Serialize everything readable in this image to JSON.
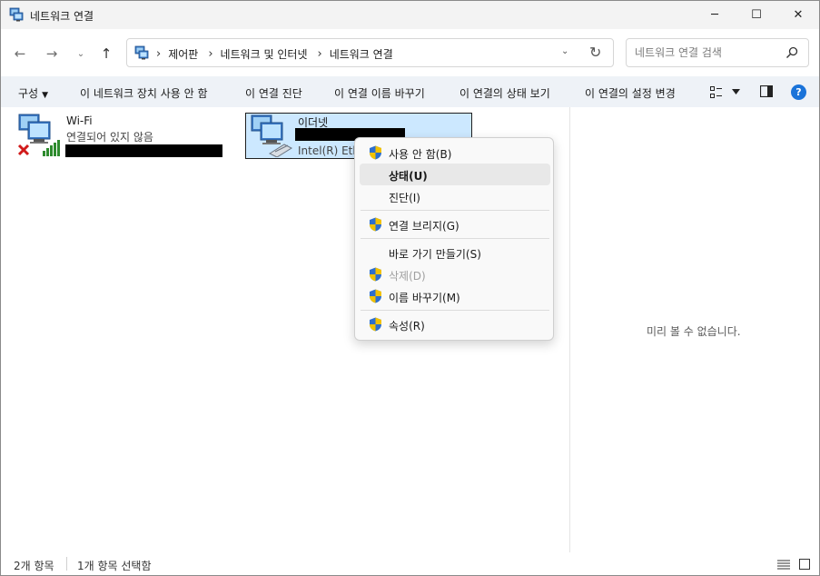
{
  "window": {
    "title": "네트워크 연결",
    "controls": {
      "minimize": "─",
      "maximize": "☐",
      "close": "✕"
    }
  },
  "navigation": {
    "back": "←",
    "forward": "→",
    "recent": "⌄",
    "up": "↑",
    "breadcrumbs": [
      "제어판",
      "네트워크 및 인터넷",
      "네트워크 연결"
    ],
    "breadcrumb_separator": "›",
    "dropdown": "⌄",
    "refresh": "↻"
  },
  "search": {
    "placeholder": "네트워크 연결 검색",
    "value": ""
  },
  "commands": {
    "organize": "구성",
    "disable": "이 네트워크 장치 사용 안 함",
    "diagnose": "이 연결 진단",
    "rename": "이 연결 이름 바꾸기",
    "view_status": "이 연결의 상태 보기",
    "change_settings": "이 연결의 설정 변경",
    "help": "?"
  },
  "connections": [
    {
      "name": "Wi-Fi",
      "status": "연결되어 있지 않음",
      "disconnected": true,
      "selected": false
    },
    {
      "name": "이더넷",
      "adapter": "Intel(R) Ethe",
      "disconnected": false,
      "selected": true
    }
  ],
  "context_menu": {
    "items": [
      {
        "label": "사용 안 함(B)",
        "shield": true,
        "bold": false,
        "disabled": false,
        "hover": false
      },
      {
        "label": "상태(U)",
        "shield": false,
        "bold": true,
        "disabled": false,
        "hover": true
      },
      {
        "label": "진단(I)",
        "shield": false,
        "bold": false,
        "disabled": false,
        "hover": false
      },
      {
        "label": "연결 브리지(G)",
        "shield": true,
        "bold": false,
        "disabled": false,
        "hover": false
      },
      {
        "label": "바로 가기 만들기(S)",
        "shield": false,
        "bold": false,
        "disabled": false,
        "hover": false
      },
      {
        "label": "삭제(D)",
        "shield": true,
        "bold": false,
        "disabled": true,
        "hover": false
      },
      {
        "label": "이름 바꾸기(M)",
        "shield": true,
        "bold": false,
        "disabled": false,
        "hover": false
      },
      {
        "label": "속성(R)",
        "shield": true,
        "bold": false,
        "disabled": false,
        "hover": false
      }
    ]
  },
  "preview": {
    "message": "미리 볼 수 없습니다."
  },
  "statusbar": {
    "item_count": "2개 항목",
    "selected_count": "1개 항목 선택함"
  },
  "colors": {
    "selection": "#cce8ff",
    "command_bar": "#eef2f7",
    "help_blue": "#1a73d9",
    "error_red": "#d11a1a",
    "signal_green": "#2e8b2e"
  }
}
